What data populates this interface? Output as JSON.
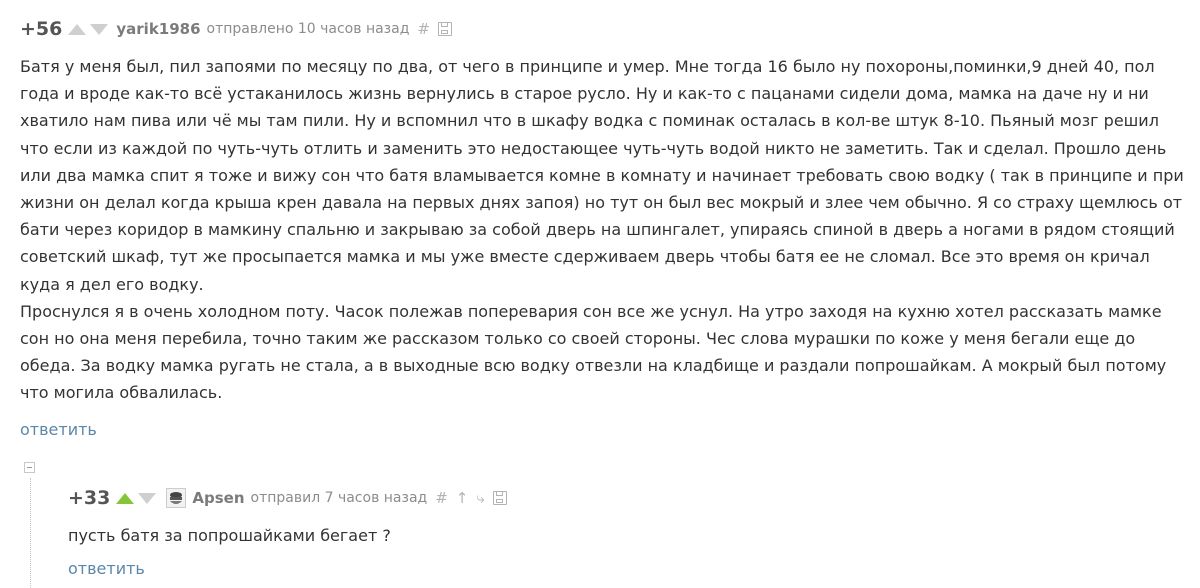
{
  "comment1": {
    "rating": "+56",
    "username": "yarik1986",
    "meta": "отправлено 10 часов назад",
    "hash_icon": "#",
    "paragraphs": [
      "Батя у меня был, пил запоями по месяцу по два, от чего в принципе и умер. Мне тогда 16 было ну похороны,поминки,9 дней 40, пол года и вроде как-то всё устаканилось жизнь вернулись в старое русло. Ну и как-то с пацанами сидели дома, мамка на даче ну и ни хватило нам пива или чё мы там пили. Ну и вспомнил что в шкафу водка с поминак осталась в кол-ве штук 8-10. Пьяный мозг решил что если из каждой по чуть-чуть отлить и заменить это недостающее чуть-чуть водой никто не заметить. Так и сделал. Прошло день или два мамка спит я тоже и вижу сон что батя вламывается комне в комнату и начинает требовать свою водку ( так в принципе и при жизни он делал когда крыша крен давала на первых днях запоя) но тут он был вес мокрый и злее чем обычно. Я со страху щемлюсь от бати через коридор в мамкину спальню и закрываю за собой дверь на шпингалет, упираясь спиной в дверь а ногами в рядом стоящий советский шкаф, тут же просыпается мамка и мы уже вместе сдерживаем дверь чтобы батя ее не сломал. Все это время он кричал куда я дел его водку.",
      "Проснулся я в очень холодном поту. Часок полежав поперевария сон все же уснул. На утро заходя на кухню хотел рассказать мамке сон но она меня перебила, точно таким же рассказом только со своей стороны. Чес слова мурашки по коже у меня бегали еще до обеда. За водку мамка ругать не стала, а в выходные всю водку отвезли на кладбище и раздали попрошайкам. А мокрый был потому что могила обвалилась."
    ],
    "reply_label": "ответить",
    "icons": {
      "save": "save-icon"
    }
  },
  "comment2": {
    "rating": "+33",
    "username": "Apsen",
    "meta": "отправил 7 часов назад",
    "hash_icon": "#",
    "up_icon": "↑",
    "branch_icon": "⤷",
    "text": "пусть батя за попрошайками бегает ?",
    "reply_label": "ответить",
    "colors": {
      "upvoted": "#86c53a"
    }
  },
  "colors": {
    "link": "#5b87a8",
    "text": "#333333",
    "muted": "#8c8c8c"
  }
}
